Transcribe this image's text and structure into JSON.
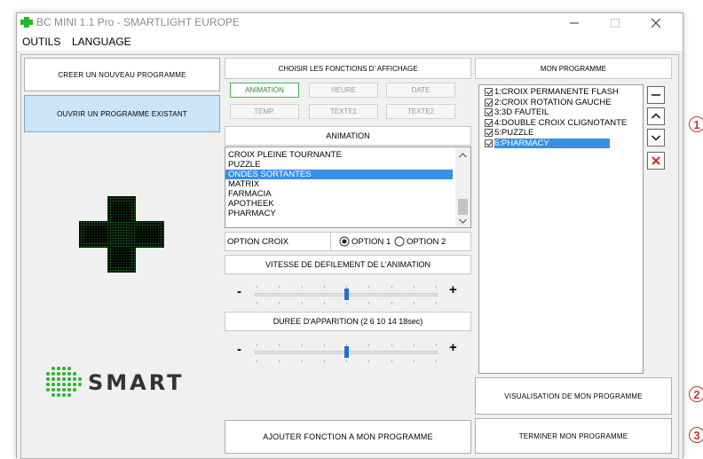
{
  "window": {
    "title": "BC MINI 1.1 Pro - SMARTLIGHT EUROPE",
    "menu": [
      "OUTILS",
      "LANGUAGE"
    ]
  },
  "left_panel": {
    "new_program": "CREER UN NOUVEAU PROGRAMME",
    "open_program": "OUVRIR UN PROGRAMME EXISTANT",
    "logo_text": "SMART"
  },
  "middle_panel": {
    "choose_header": "CHOISIR LES FONCTIONS D' AFFICHAGE",
    "tags": [
      "ANIMATION",
      "HEURE",
      "DATE",
      "TEMP.",
      "TEXTE1",
      "TEXTE2"
    ],
    "animation_header": "ANIMATION",
    "animations": [
      "CROIX PLEINE TOURNANTE",
      "PUZZLE",
      "ONDES SORTANTES",
      "MATRIX",
      "FARMACIA",
      "APOTHEEK",
      "PHARMACY"
    ],
    "selected_animation": "ONDES SORTANTES",
    "option_label": "OPTION CROIX",
    "option1": "OPTION 1",
    "option2": "OPTION 2",
    "selected_option": "OPTION 1",
    "speed_label": "VITESSE DE DEFILEMENT DE L'ANIMATION",
    "speed_level": 0.5,
    "duration_label": "DUREE D'APPARITION (2 6 10 14 18sec)",
    "duration_level": 0.5,
    "minus": "-",
    "plus": "+",
    "add_button": "AJOUTER FONCTION A MON PROGRAMME"
  },
  "right_panel": {
    "header": "MON PROGRAMME",
    "items": [
      "1:CROIX PERMANENTE FLASH",
      "2:CROIX ROTATION GAUCHE",
      "3:3D FAUTEIL",
      "4:DOUBLE CROIX CLIGNOTANTE",
      "5:PUZZLE",
      "6:PHARMACY"
    ],
    "selected_item": "6:PHARMACY",
    "side_icons": [
      "minus-icon",
      "chevron-up-icon",
      "chevron-down-icon",
      "delete-x-icon"
    ],
    "visualise_button": "VISUALISATION DE MON PROGRAMME",
    "finish_button": "TERMINER MON PROGRAMME"
  },
  "callouts": [
    "1",
    "2",
    "3"
  ],
  "colors": {
    "accent_selection": "#3a8ee6",
    "brand_green": "#2ab52a",
    "callout_red": "#c0392b",
    "delete_red": "#d9221b"
  }
}
